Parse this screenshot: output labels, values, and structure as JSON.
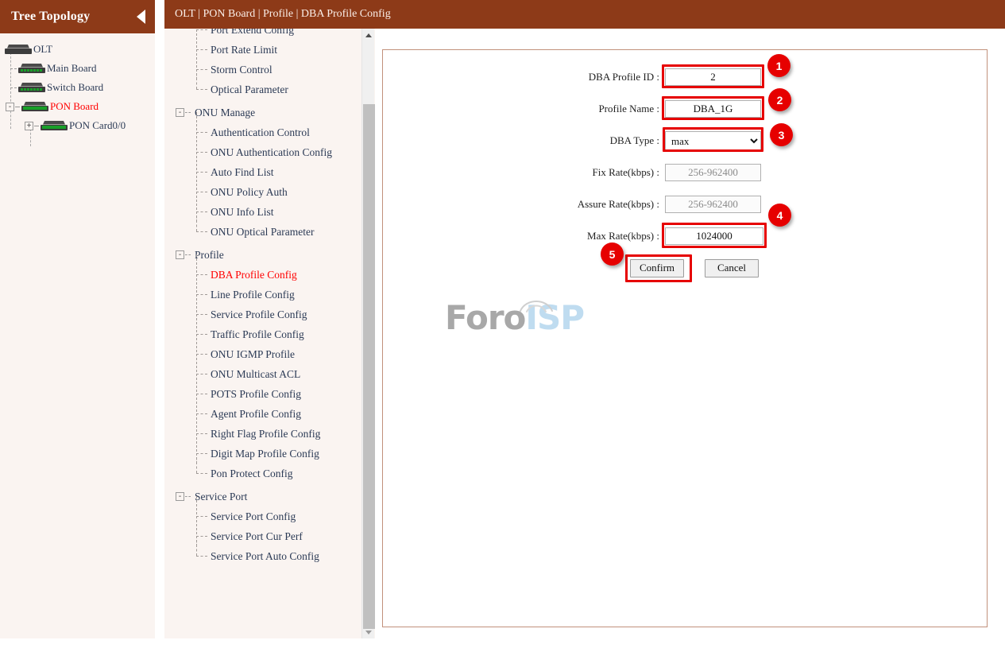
{
  "sidebar": {
    "title": "Tree Topology",
    "collapse_icon": "caret-left-icon",
    "nodes": [
      {
        "label": "OLT",
        "icon": "device-icon",
        "expander": null,
        "depth": 0,
        "red": false
      },
      {
        "label": "Main Board",
        "icon": "device-icon",
        "expander": "-",
        "depth": 1,
        "red": false
      },
      {
        "label": "Switch Board",
        "icon": "device-icon",
        "expander": "-",
        "depth": 1,
        "red": false
      },
      {
        "label": "PON Board",
        "icon": "device-icon",
        "expander": "-",
        "depth": 1,
        "red": true
      },
      {
        "label": "PON Card0/0",
        "icon": "device-icon",
        "expander": "+",
        "depth": 2,
        "red": false
      }
    ]
  },
  "header": {
    "breadcrumb": "OLT | PON Board | Profile | DBA Profile Config"
  },
  "menu": {
    "scroll": {
      "up_icon": "scroll-up-arrow-icon",
      "down_icon": "scroll-down-arrow-icon"
    },
    "items": [
      {
        "type": "item",
        "label": "Port Extend Config",
        "active": false
      },
      {
        "type": "item",
        "label": "Port Rate Limit",
        "active": false
      },
      {
        "type": "item",
        "label": "Storm Control",
        "active": false
      },
      {
        "type": "item",
        "label": "Optical Parameter",
        "active": false,
        "last": true
      },
      {
        "type": "group",
        "label": "ONU Manage",
        "expander": "-"
      },
      {
        "type": "item",
        "label": "Authentication Control",
        "active": false
      },
      {
        "type": "item",
        "label": "ONU Authentication Config",
        "active": false
      },
      {
        "type": "item",
        "label": "Auto Find List",
        "active": false
      },
      {
        "type": "item",
        "label": "ONU Policy Auth",
        "active": false
      },
      {
        "type": "item",
        "label": "ONU Info List",
        "active": false
      },
      {
        "type": "item",
        "label": "ONU Optical Parameter",
        "active": false,
        "last": true
      },
      {
        "type": "group",
        "label": "Profile",
        "expander": "-"
      },
      {
        "type": "item",
        "label": "DBA Profile Config",
        "active": true
      },
      {
        "type": "item",
        "label": "Line Profile Config",
        "active": false
      },
      {
        "type": "item",
        "label": "Service Profile Config",
        "active": false
      },
      {
        "type": "item",
        "label": "Traffic Profile Config",
        "active": false
      },
      {
        "type": "item",
        "label": "ONU IGMP Profile",
        "active": false
      },
      {
        "type": "item",
        "label": "ONU Multicast ACL",
        "active": false
      },
      {
        "type": "item",
        "label": "POTS Profile Config",
        "active": false
      },
      {
        "type": "item",
        "label": "Agent Profile Config",
        "active": false
      },
      {
        "type": "item",
        "label": "Right Flag Profile Config",
        "active": false
      },
      {
        "type": "item",
        "label": "Digit Map Profile Config",
        "active": false
      },
      {
        "type": "item",
        "label": "Pon Protect Config",
        "active": false,
        "last": true
      },
      {
        "type": "group",
        "label": "Service Port",
        "expander": "-"
      },
      {
        "type": "item",
        "label": "Service Port Config",
        "active": false
      },
      {
        "type": "item",
        "label": "Service Port Cur Perf",
        "active": false
      },
      {
        "type": "item",
        "label": "Service Port Auto Config",
        "active": false,
        "last": true
      }
    ]
  },
  "form": {
    "fields": [
      {
        "label": "DBA Profile ID :",
        "value": "2",
        "placeholder": "",
        "kind": "text",
        "disabled": false,
        "highlighted": true
      },
      {
        "label": "Profile Name :",
        "value": "DBA_1G",
        "placeholder": "",
        "kind": "text",
        "disabled": false,
        "highlighted": true
      },
      {
        "label": "DBA Type :",
        "value": "max",
        "placeholder": "",
        "kind": "select",
        "disabled": false,
        "highlighted": true
      },
      {
        "label": "Fix Rate(kbps) :",
        "value": "",
        "placeholder": "256-962400",
        "kind": "text",
        "disabled": true,
        "highlighted": false
      },
      {
        "label": "Assure Rate(kbps) :",
        "value": "",
        "placeholder": "256-962400",
        "kind": "text",
        "disabled": true,
        "highlighted": false
      },
      {
        "label": "Max Rate(kbps) :",
        "value": "1024000",
        "placeholder": "",
        "kind": "text",
        "disabled": false,
        "highlighted": true
      }
    ],
    "dba_type_options": [
      "max"
    ],
    "confirm_label": "Confirm",
    "cancel_label": "Cancel"
  },
  "callouts": [
    {
      "number": "1"
    },
    {
      "number": "2"
    },
    {
      "number": "3"
    },
    {
      "number": "4"
    },
    {
      "number": "5"
    }
  ],
  "watermark": {
    "part1": "Foro",
    "part2": "ISP"
  },
  "colors": {
    "header_brown": "#8d3a18",
    "panel_cream": "#faf4f1",
    "accent_red": "#e60000",
    "active_link_red": "#ff0000",
    "panel_border": "#c2917c",
    "link_blue": "#2b3a55"
  }
}
